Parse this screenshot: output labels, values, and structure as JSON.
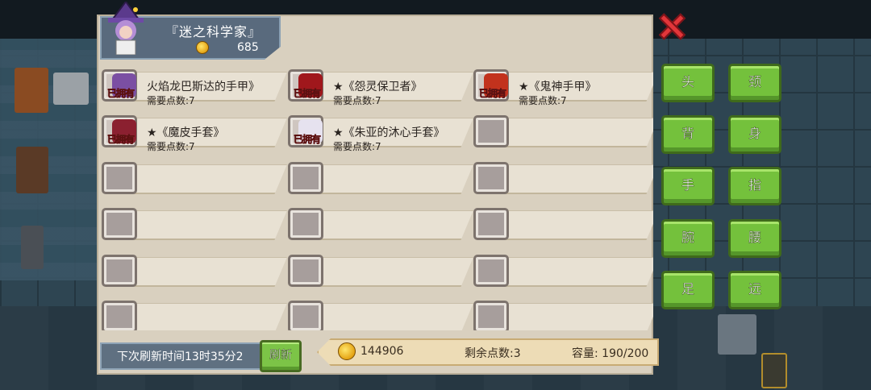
{
  "header": {
    "title": "『迷之科学家』",
    "gold": "685"
  },
  "owned_label": "已拥有",
  "items": [
    {
      "name": "火焰龙巴斯达的手甲》",
      "cost": "需要点数:7",
      "owned": true,
      "color": "#7b4fa3"
    },
    {
      "name": "★《怨灵保卫者》",
      "cost": "需要点数:7",
      "owned": true,
      "color": "#a0171c"
    },
    {
      "name": "★《鬼神手甲》",
      "cost": "需要点数:7",
      "owned": true,
      "color": "#c2321d"
    },
    {
      "name": "★《魔皮手套》",
      "cost": "需要点数:7",
      "owned": true,
      "color": "#8b2030"
    },
    {
      "name": "★《朱亚的沐心手套》",
      "cost": "需要点数:7",
      "owned": true,
      "color": "#e6e2ef"
    },
    {
      "name": "",
      "cost": "",
      "owned": false
    },
    {
      "name": "",
      "cost": "",
      "owned": false
    },
    {
      "name": "",
      "cost": "",
      "owned": false
    },
    {
      "name": "",
      "cost": "",
      "owned": false
    },
    {
      "name": "",
      "cost": "",
      "owned": false
    },
    {
      "name": "",
      "cost": "",
      "owned": false
    },
    {
      "name": "",
      "cost": "",
      "owned": false
    },
    {
      "name": "",
      "cost": "",
      "owned": false
    },
    {
      "name": "",
      "cost": "",
      "owned": false
    },
    {
      "name": "",
      "cost": "",
      "owned": false
    },
    {
      "name": "",
      "cost": "",
      "owned": false
    },
    {
      "name": "",
      "cost": "",
      "owned": false
    },
    {
      "name": "",
      "cost": "",
      "owned": false
    }
  ],
  "footer": {
    "refresh_text": "下次刷新时间13时35分2",
    "refresh_button": "刷新",
    "gold": "144906",
    "points": "剩余点数:3",
    "capacity": "容量: 190/200"
  },
  "categories": [
    "头",
    "颈",
    "背",
    "身",
    "手",
    "指",
    "腕",
    "腰",
    "足",
    "远"
  ],
  "colors": {
    "button_green": "#74c13c",
    "close_red": "#e2363a",
    "panel": "#d9d0bf"
  }
}
